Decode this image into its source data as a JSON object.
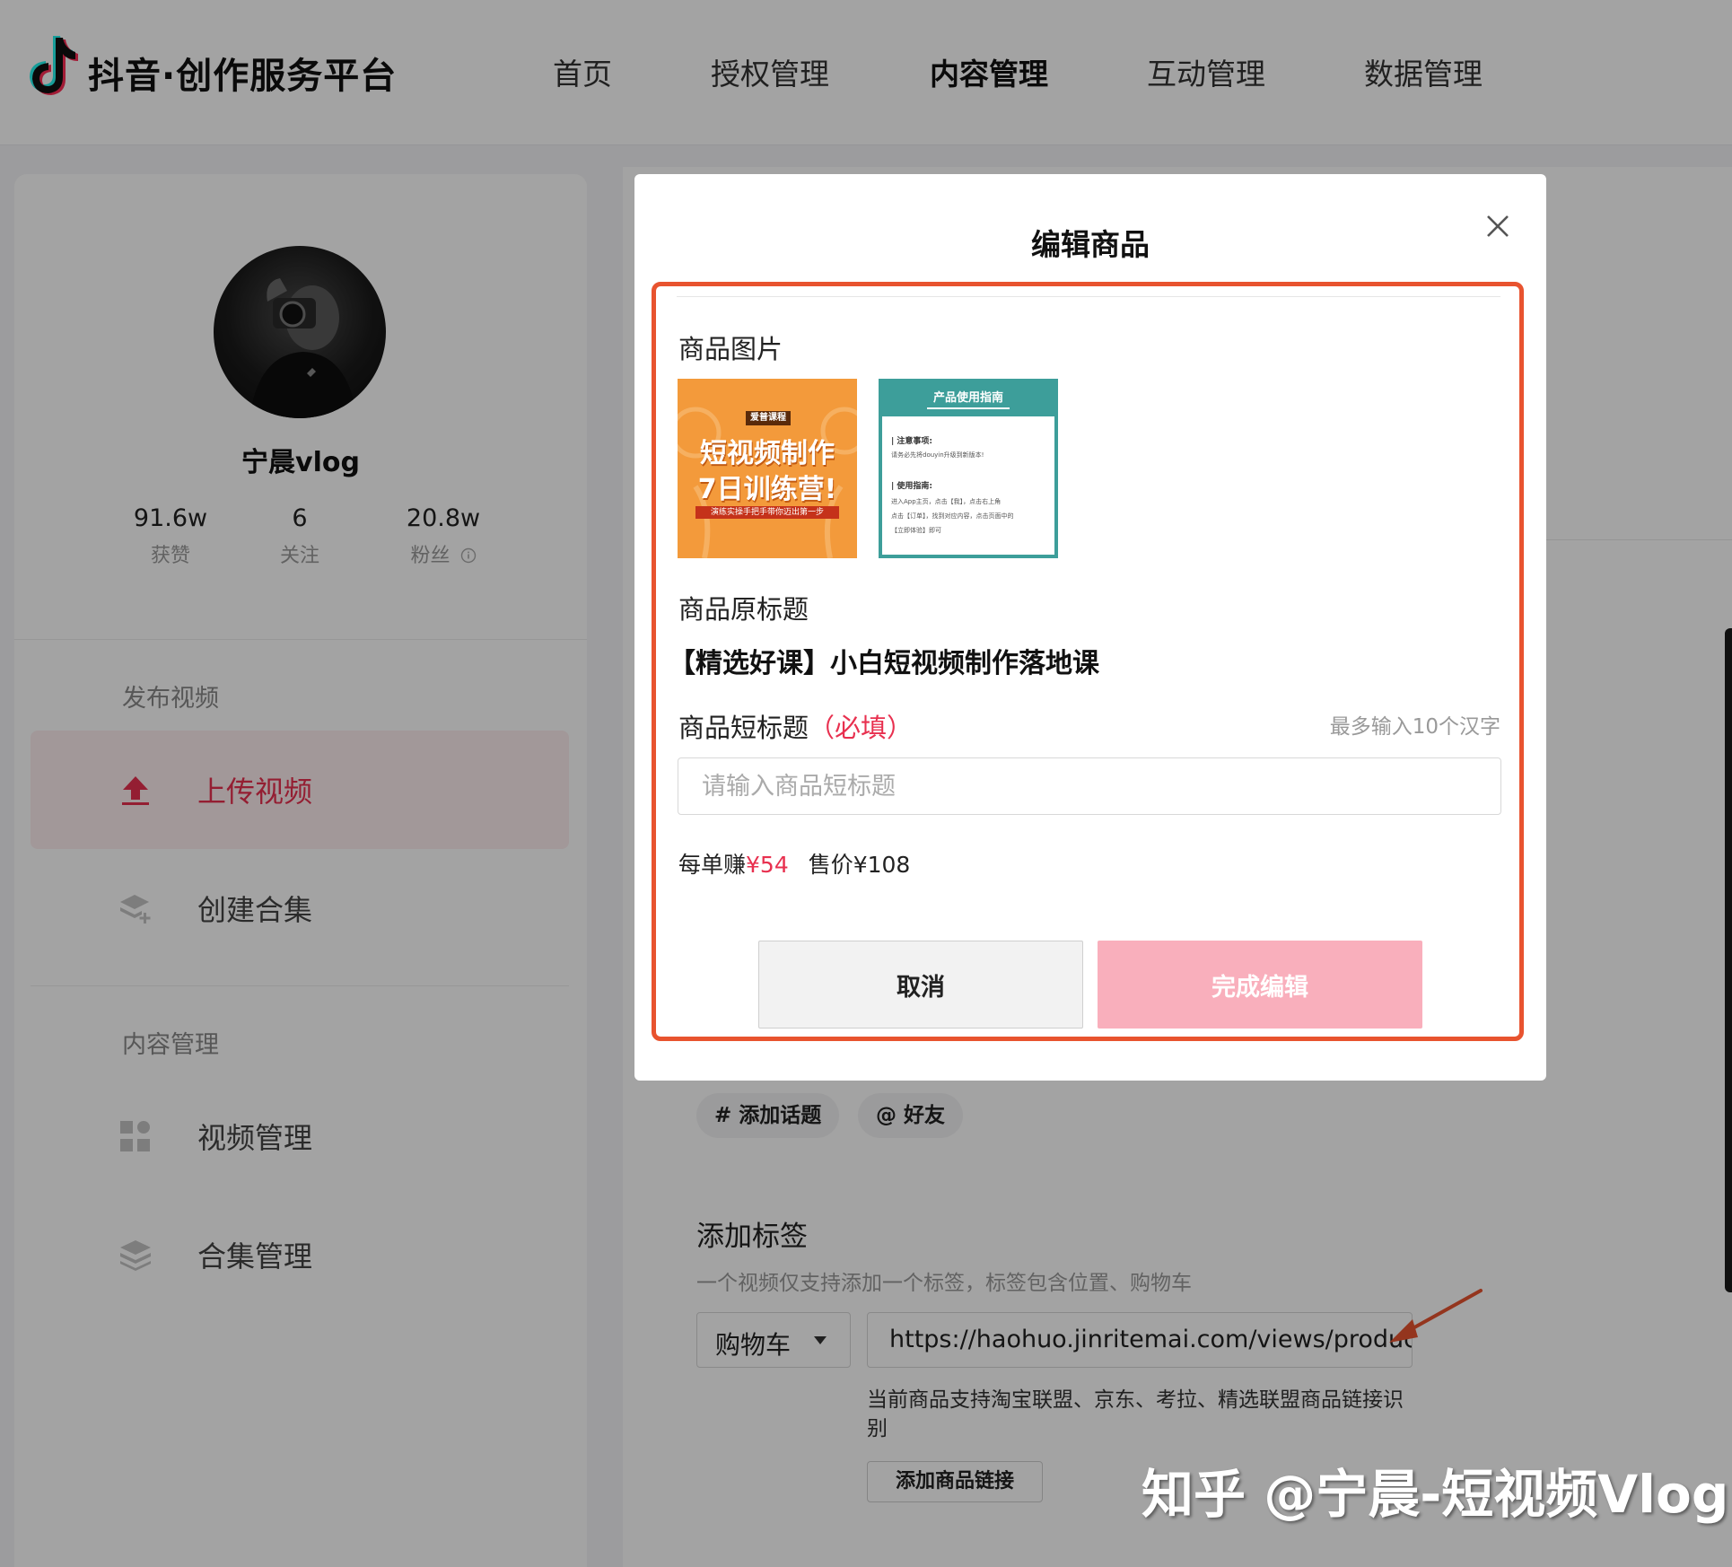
{
  "header": {
    "brand": "抖音·创作服务平台",
    "nav": [
      "首页",
      "授权管理",
      "内容管理",
      "互动管理",
      "数据管理"
    ],
    "active_nav": "内容管理"
  },
  "profile": {
    "username": "宁晨vlog",
    "stats": [
      {
        "value": "91.6w",
        "label": "获赞"
      },
      {
        "value": "6",
        "label": "关注"
      },
      {
        "value": "20.8w",
        "label": "粉丝"
      }
    ]
  },
  "sidebar": {
    "section1": "发布视频",
    "upload": "上传视频",
    "create_collection": "创建合集",
    "section2": "内容管理",
    "video_manage": "视频管理",
    "collection_manage": "合集管理"
  },
  "content": {
    "chip_topic": "# 添加话题",
    "chip_friend": "@ 好友",
    "tag_title": "添加标签",
    "tag_desc": "一个视频仅支持添加一个标签，标签包含位置、购物车",
    "tag_type": "购物车",
    "product_url": "https://haohuo.jinritemai.com/views/produc",
    "support_hint": "当前商品支持淘宝联盟、京东、考拉、精选联盟商品链接识别",
    "add_link": "添加商品链接"
  },
  "modal": {
    "title": "编辑商品",
    "images_label": "商品图片",
    "thumb1": {
      "badge": "爱普课程",
      "line1": "短视频制作",
      "line2": "7日训练营!",
      "footer": "演练实操手把手带你迈出第一步"
    },
    "thumb2": {
      "header": "产品使用指南",
      "note_title": "| 注意事项:",
      "note_text": "请务必先将douyin升级到新版本!",
      "guide_title": "| 使用指南:",
      "guide_line1": "进入App主页，点击【我】，点击右上角",
      "guide_line2": "点击【订单】，找到对应内容，点击页面中的",
      "guide_line3": "【立即体验】即可"
    },
    "original_title_label": "商品原标题",
    "original_title": "【精选好课】小白短视频制作落地课",
    "short_title_label": "商品短标题",
    "required": "（必填）",
    "limit_hint": "最多输入10个汉字",
    "short_title_placeholder": "请输入商品短标题",
    "earn_label": "每单赚",
    "earn_value": "¥54",
    "price_label": "售价",
    "price_value": "¥108",
    "cancel": "取消",
    "done": "完成编辑"
  },
  "watermark": "知乎 @宁晨-短视频Vlog",
  "colors": {
    "accent": "#e8304f",
    "highlight_border": "#e8532f",
    "done_button": "#f9afbc"
  }
}
